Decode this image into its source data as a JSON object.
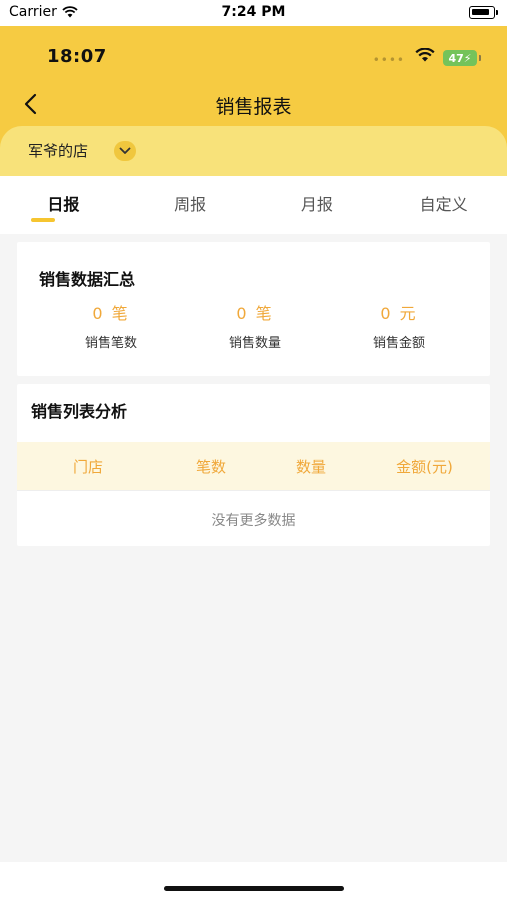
{
  "sim_status": {
    "carrier": "Carrier",
    "time": "7:24 PM"
  },
  "device_status": {
    "time": "18:07",
    "battery": "47"
  },
  "nav": {
    "title": "销售报表"
  },
  "store": {
    "name": "军爷的店"
  },
  "tabs": [
    {
      "label": "日报",
      "active": true
    },
    {
      "label": "周报",
      "active": false
    },
    {
      "label": "月报",
      "active": false
    },
    {
      "label": "自定义",
      "active": false
    }
  ],
  "summary": {
    "title": "销售数据汇总",
    "stats": [
      {
        "value": "0 笔",
        "label": "销售笔数"
      },
      {
        "value": "0 笔",
        "label": "销售数量"
      },
      {
        "value": "0 元",
        "label": "销售金额"
      }
    ]
  },
  "list": {
    "title": "销售列表分析",
    "columns": [
      "门店",
      "笔数",
      "数量",
      "金额(元)"
    ],
    "empty_text": "没有更多数据"
  },
  "colors": {
    "header_yellow": "#f6cb42",
    "strip_yellow": "#f8e27a",
    "accent_orange": "#f0a83a",
    "table_header_bg": "#fdf7e0",
    "battery_green": "#74c35a"
  }
}
